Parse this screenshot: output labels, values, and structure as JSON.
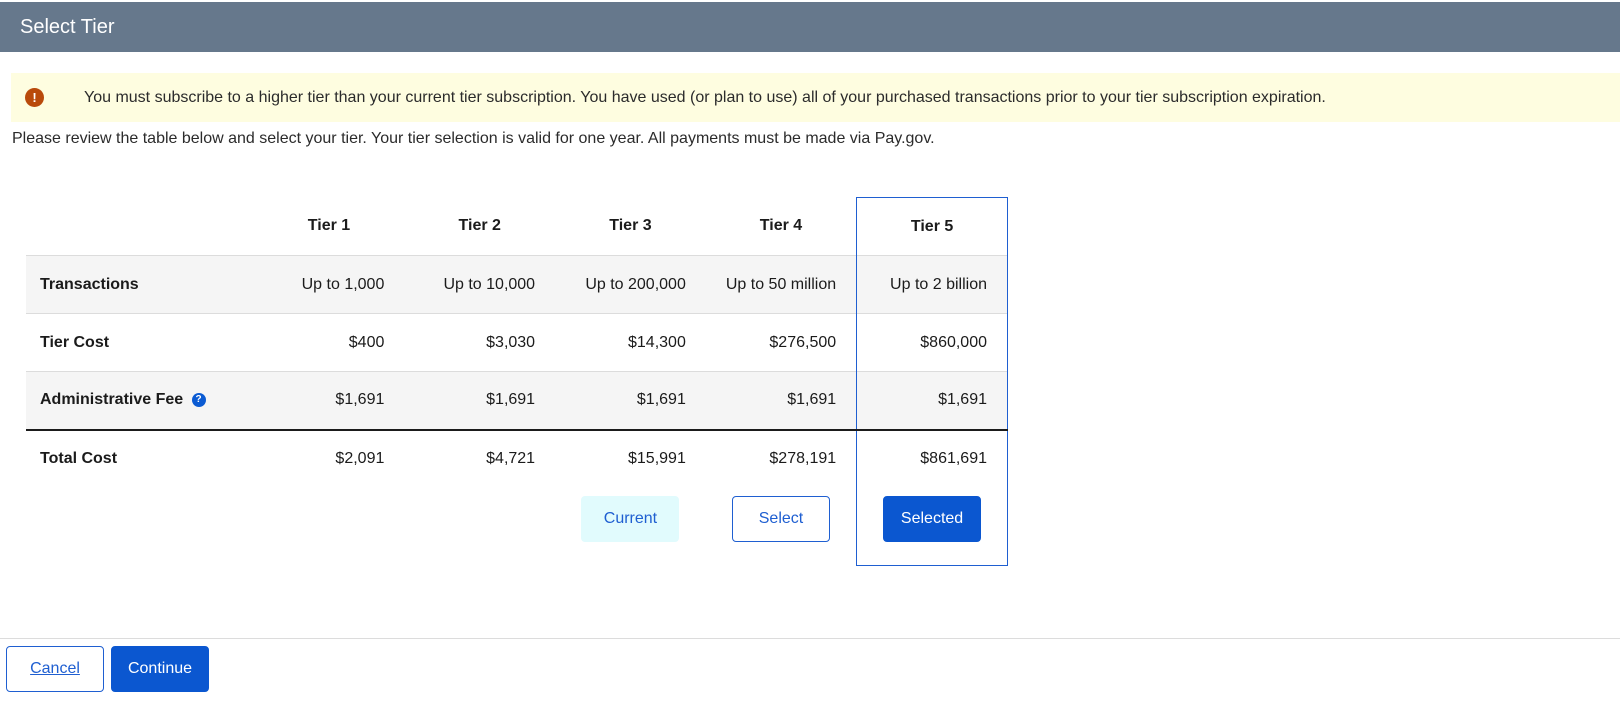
{
  "header": {
    "title": "Select Tier"
  },
  "alert": {
    "icon": "exclamation-circle-icon",
    "message": "You must subscribe to a higher tier than your current tier subscription. You have used (or plan to use) all of your purchased transactions prior to your tier subscription expiration."
  },
  "intro": "Please review the table below and select your tier. Your tier selection is valid for one year. All payments must be made via Pay.gov.",
  "table": {
    "tiers": [
      "Tier 1",
      "Tier 2",
      "Tier 3",
      "Tier 4",
      "Tier 5"
    ],
    "rows": [
      {
        "label": "Transactions",
        "values": [
          "Up to 1,000",
          "Up to 10,000",
          "Up to 200,000",
          "Up to 50 million",
          "Up to 2 billion"
        ]
      },
      {
        "label": "Tier Cost",
        "values": [
          "$400",
          "$3,030",
          "$14,300",
          "$276,500",
          "$860,000"
        ]
      },
      {
        "label": "Administrative Fee",
        "values": [
          "$1,691",
          "$1,691",
          "$1,691",
          "$1,691",
          "$1,691"
        ]
      },
      {
        "label": "Total Cost",
        "values": [
          "$2,091",
          "$4,721",
          "$15,991",
          "$278,191",
          "$861,691"
        ]
      }
    ],
    "actions": {
      "tier3": "Current",
      "tier4": "Select",
      "tier5": "Selected"
    },
    "selected_tier": "Tier 5"
  },
  "footer": {
    "cancel": "Cancel",
    "continue": "Continue"
  },
  "colors": {
    "header_bg": "#66788c",
    "alert_bg": "#fefde0",
    "alert_icon": "#b94a0b",
    "primary": "#0b57d0",
    "current_bg": "#e1fbfd"
  }
}
